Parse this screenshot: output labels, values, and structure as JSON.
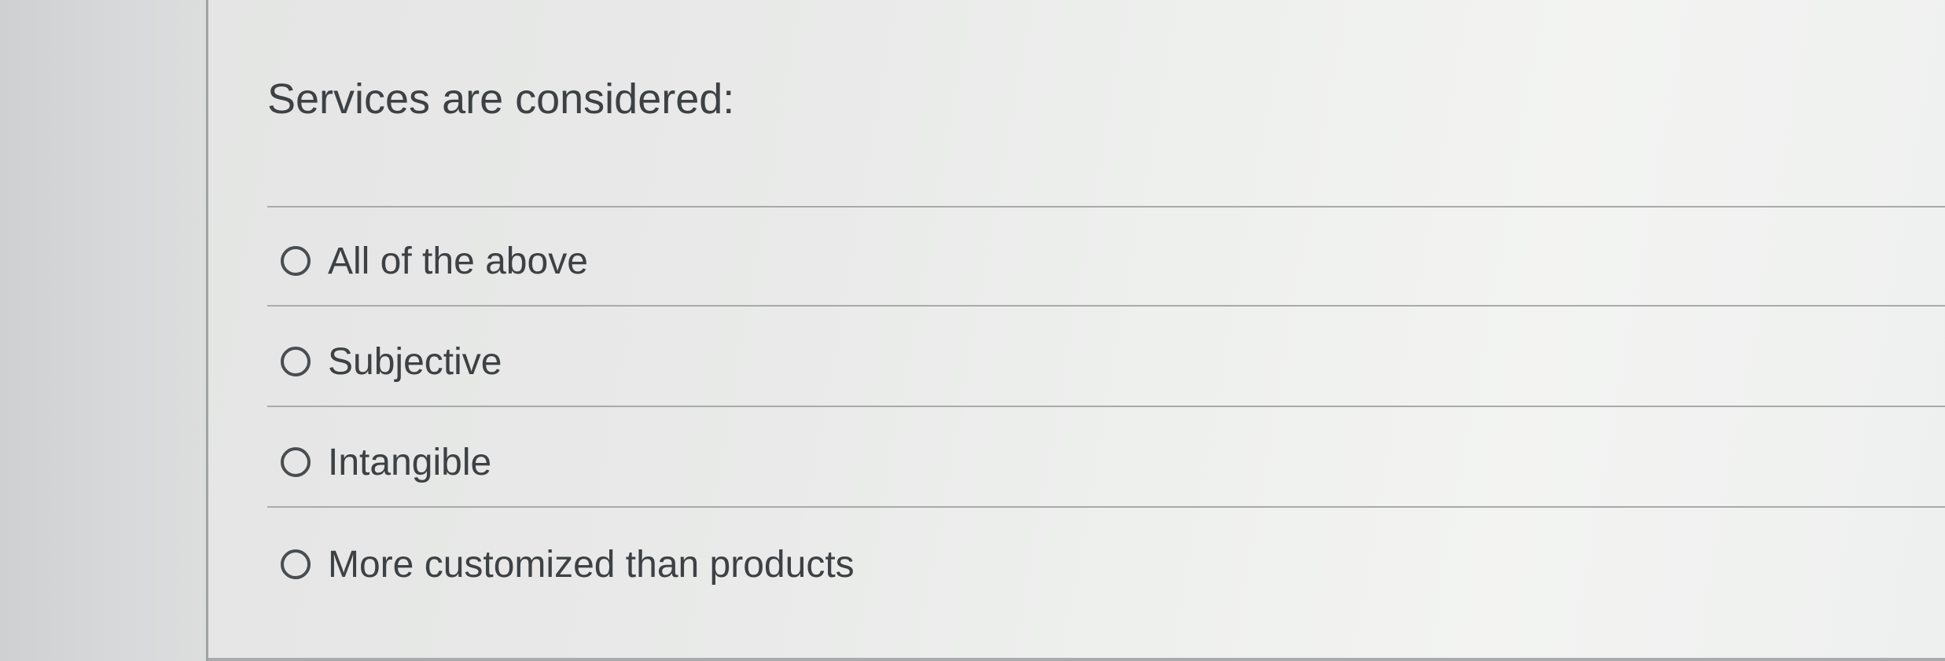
{
  "question": {
    "text": "Services are considered:"
  },
  "options": [
    {
      "label": "All of the above",
      "selected": false
    },
    {
      "label": "Subjective",
      "selected": false
    },
    {
      "label": "Intangible",
      "selected": false
    },
    {
      "label": "More customized than products",
      "selected": false
    }
  ],
  "colors": {
    "text": "#3e4144",
    "divider": "#a8aaab",
    "panel_border": "#9fa1a3"
  },
  "icons": {
    "radio": "radio-unchecked-icon"
  }
}
